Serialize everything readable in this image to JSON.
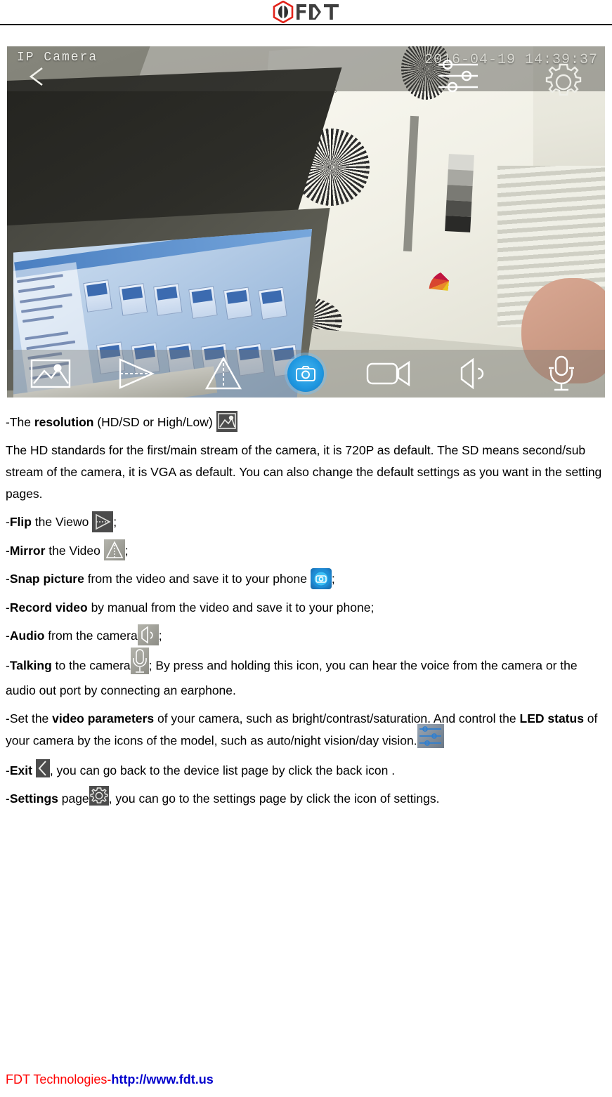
{
  "header": {
    "logo_name": "FDT",
    "logo_colors": {
      "hex_red": "#e2231a",
      "hex_dark": "#3f3f3f"
    }
  },
  "video_panel": {
    "overlay_title": "IP Camera",
    "timestamp": "2016-04-19 14:39:37",
    "back_icon": "back-chevron-icon",
    "top_icons": [
      "sliders-icon",
      "gear-icon"
    ],
    "toolbar_icons": [
      {
        "name": "resolution-icon",
        "label": "resolution"
      },
      {
        "name": "flip-icon",
        "label": "flip"
      },
      {
        "name": "mirror-icon",
        "label": "mirror"
      },
      {
        "name": "snap-picture-icon",
        "label": "snap picture"
      },
      {
        "name": "record-video-icon",
        "label": "record video"
      },
      {
        "name": "audio-icon",
        "label": "audio"
      },
      {
        "name": "talk-microphone-icon",
        "label": "talking"
      }
    ],
    "snap_button_color": "#1f97e0"
  },
  "doc": {
    "p1_pre": "-The ",
    "p1_bold": "resolution",
    "p1_post": " (HD/SD or High/Low) ",
    "p2": "The HD standards for the first/main stream of the camera, it is 720P as default. The SD means second/sub stream of the camera, it is VGA as default. You can also change the default settings as you want in the setting pages.",
    "p3_pre": "-",
    "p3_bold": "Flip",
    "p3_post": " the Viewo ",
    "p3_end": ";",
    "p4_pre": "-",
    "p4_bold": "Mirror",
    "p4_post": " the Video ",
    "p4_end": ";",
    "p5_pre": "-",
    "p5_bold": "Snap picture",
    "p5_post": " from the video and save it to your phone ",
    "p5_end": ";",
    "p6_pre": "-",
    "p6_bold": "Record video",
    "p6_post": " by manual from the video and save it to your phone;",
    "p7_pre": "-",
    "p7_bold": "Audio",
    "p7_post": " from the camera",
    "p7_end": ";",
    "p8_pre": "-",
    "p8_bold": "Talking",
    "p8_post": " to the camera",
    "p8_end": "; By press and holding this icon, you can hear the voice from the camera or the audio out port by connecting an earphone.",
    "p9_pre": "-Set the ",
    "p9_bold1": "video parameters",
    "p9_mid": " of your camera, such as bright/contrast/saturation. And control the ",
    "p9_bold2": "LED status",
    "p9_post": " of your camera by the icons of the model, such as auto/night vision/day vision.",
    "p10_pre": "-",
    "p10_bold": "Exit",
    "p10_post": ", you can go back to the device list page by click the back icon .",
    "p11_pre": "-",
    "p11_bold": "Settings",
    "p11_mid": " page",
    "p11_post": ", you can go to the settings page by click the icon of settings."
  },
  "footer": {
    "company": "FDT Technologies-",
    "url": "http://www.fdt.us",
    "company_color": "#ff0000",
    "url_color": "#0000cc"
  }
}
